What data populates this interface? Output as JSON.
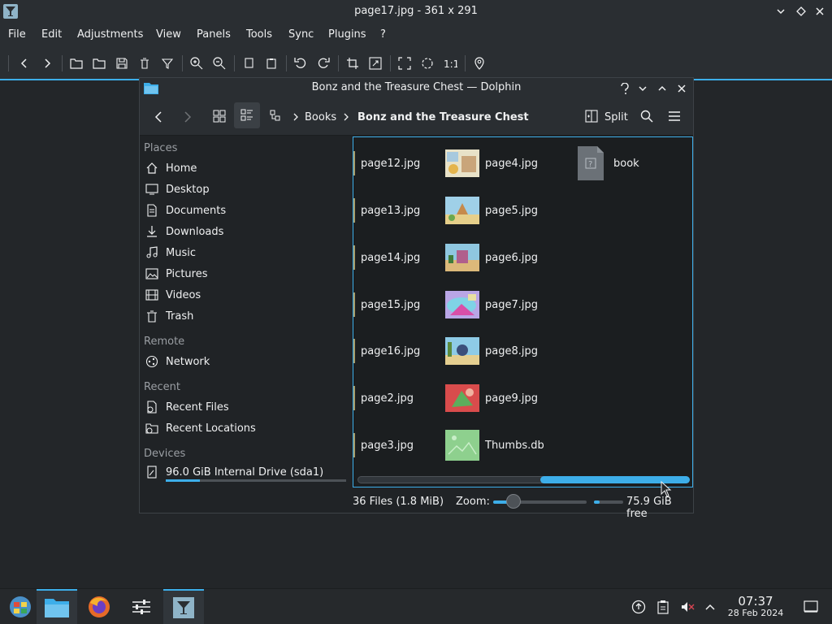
{
  "app": {
    "title": "page17.jpg - 361 x 291",
    "menu": [
      "File",
      "Edit",
      "Adjustments",
      "View",
      "Panels",
      "Tools",
      "Sync",
      "Plugins",
      "?"
    ]
  },
  "dolphin": {
    "title": "Bonz and the Treasure Chest — Dolphin",
    "breadcrumb": [
      "Books",
      "Bonz and the Treasure Chest"
    ],
    "split_label": "Split",
    "places_title": "Places",
    "places": [
      "Home",
      "Desktop",
      "Documents",
      "Downloads",
      "Music",
      "Pictures",
      "Videos",
      "Trash"
    ],
    "remote_title": "Remote",
    "remote": [
      "Network"
    ],
    "recent_title": "Recent",
    "recent": [
      "Recent Files",
      "Recent Locations"
    ],
    "devices_title": "Devices",
    "devices": [
      "96.0 GiB Internal Drive (sda1)"
    ],
    "drive_usage_fraction": 0.19,
    "files_col1": [
      "page12.jpg",
      "page13.jpg",
      "page14.jpg",
      "page15.jpg",
      "page16.jpg",
      "page2.jpg",
      "page3.jpg"
    ],
    "files_col2": [
      "page4.jpg",
      "page5.jpg",
      "page6.jpg",
      "page7.jpg",
      "page8.jpg",
      "page9.jpg",
      "Thumbs.db"
    ],
    "files_col3": [
      "book"
    ],
    "status": {
      "count": "36 Files (1.8 MiB)",
      "zoom_label": "Zoom:",
      "zoom_fraction": 0.22,
      "free": "75.9 GiB free",
      "free_fraction": 0.2
    }
  },
  "taskbar": {
    "time": "07:37",
    "date": "28 Feb 2024"
  },
  "colors": {
    "accent": "#3daee9",
    "window_bg": "#2a2e32",
    "panel_bg": "#202326"
  }
}
